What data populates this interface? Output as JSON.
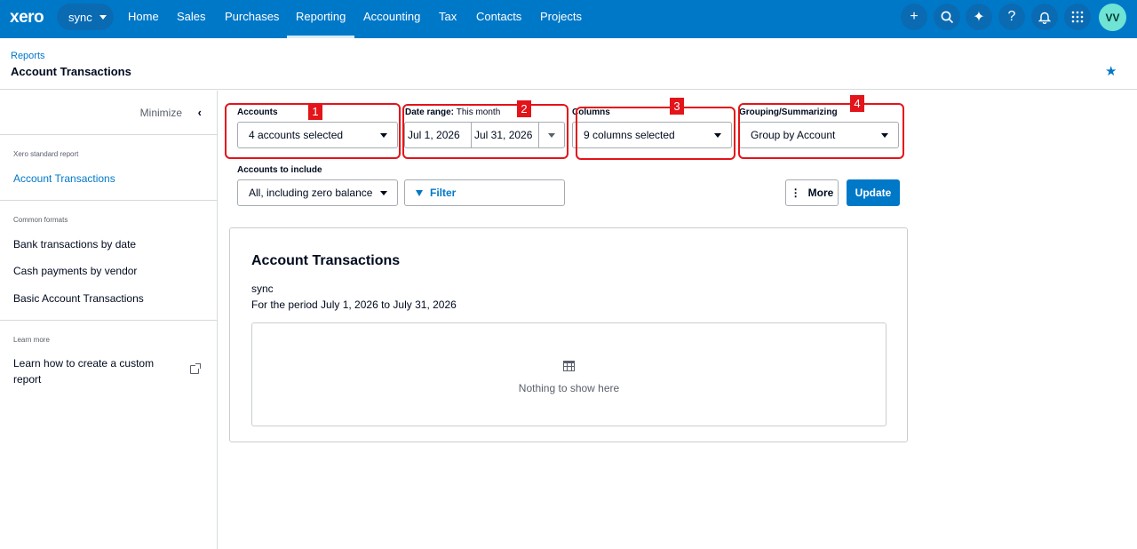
{
  "nav": {
    "logo": "xero",
    "org": "sync",
    "items": [
      "Home",
      "Sales",
      "Purchases",
      "Reporting",
      "Accounting",
      "Tax",
      "Contacts",
      "Projects"
    ],
    "active": "Reporting",
    "icons": [
      "plus-icon",
      "search-icon",
      "sparkle-icon",
      "help-icon",
      "bell-icon",
      "apps-grid-icon"
    ],
    "avatar": "VV"
  },
  "header": {
    "breadcrumb": "Reports",
    "title": "Account Transactions"
  },
  "sidebar": {
    "minimize": "Minimize",
    "standard_heading": "Xero standard report",
    "standard_item": "Account Transactions",
    "formats_heading": "Common formats",
    "formats": [
      "Bank transactions by date",
      "Cash payments by vendor",
      "Basic Account Transactions"
    ],
    "learn_heading": "Learn more",
    "learn_link": "Learn how to create a custom report"
  },
  "filters": {
    "accounts_label": "Accounts",
    "accounts_value": "4 accounts selected",
    "date_label": "Date range:",
    "date_sub": "This month",
    "date_from": "Jul 1, 2026",
    "date_to": "Jul 31, 2026",
    "columns_label": "Columns",
    "columns_value": "9 columns selected",
    "grouping_label": "Grouping/Summarizing",
    "grouping_value": "Group by Account",
    "include_label": "Accounts to include",
    "include_value": "All, including zero balance",
    "filter_button": "Filter",
    "more_button": "More",
    "update_button": "Update",
    "badges": [
      "1",
      "2",
      "3",
      "4"
    ]
  },
  "report": {
    "title": "Account Transactions",
    "org": "sync",
    "period": "For the period July 1, 2026 to July 31, 2026",
    "empty": "Nothing to show here"
  },
  "colors": {
    "brand": "#0078c8",
    "annotation": "#e3141a"
  }
}
